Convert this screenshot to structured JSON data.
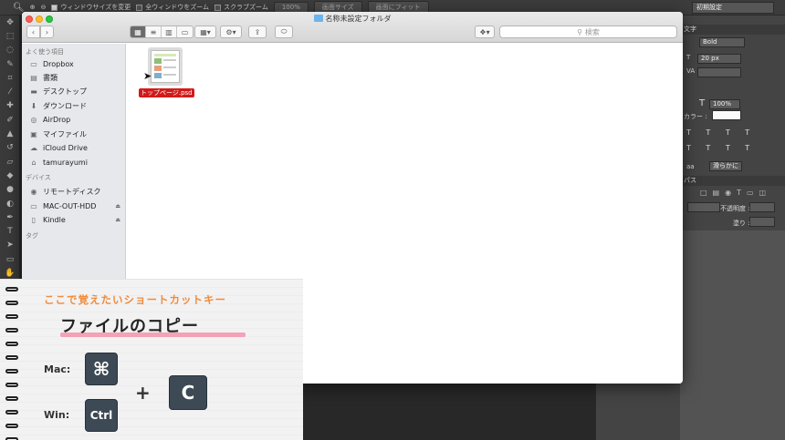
{
  "photoshop": {
    "options": {
      "resize_windows": "ウィンドウサイズを変更",
      "zoom_all": "全ウィンドウをズーム",
      "scrubby_zoom": "スクラブズーム",
      "zoom_percent": "100%",
      "fit_screen": "画面サイズ",
      "fill_screen": "画面にフィット",
      "workspace": "初期設定"
    },
    "panel": {
      "character_tab": "文字",
      "font_style": "Bold",
      "font_size": "20 px",
      "vertical_scale": "100%",
      "color_label": "カラー :",
      "type_glyphs": "T T T T",
      "type_glyphs2": "T T T T",
      "aa_label": "aa",
      "aa_value": "滑らかに",
      "paths_tab": "パス",
      "opacity_label": "不透明度 :",
      "fill_label": "塗り :"
    }
  },
  "finder": {
    "title": "名称未設定フォルダ",
    "search_placeholder": "検索",
    "sidebar": {
      "favorites_heading": "よく使う項目",
      "favorites": [
        {
          "label": "Dropbox"
        },
        {
          "label": "書類"
        },
        {
          "label": "デスクトップ"
        },
        {
          "label": "ダウンロード"
        },
        {
          "label": "AirDrop"
        },
        {
          "label": "マイファイル"
        },
        {
          "label": "iCloud Drive"
        },
        {
          "label": "tamurayumi"
        }
      ],
      "devices_heading": "デバイス",
      "devices": [
        {
          "label": "リモートディスク"
        },
        {
          "label": "MAC-OUT-HDD"
        },
        {
          "label": "Kindle"
        }
      ],
      "tags_heading": "タグ"
    },
    "files": [
      {
        "name": "トップページ.psd"
      }
    ]
  },
  "shortcut": {
    "heading": "ここで覚えたいショートカットキー",
    "action": "ファイルのコピー",
    "mac_label": "Mac:",
    "win_label": "Win:",
    "mac_key": "⌘",
    "win_key": "Ctrl",
    "plus": "+",
    "letter_key": "C"
  },
  "colors": {
    "accent_orange": "#f08c3c",
    "underline_pink": "#f3a2b8",
    "key_bg": "#3d4a55",
    "selected_file_label": "#d21a1a"
  }
}
